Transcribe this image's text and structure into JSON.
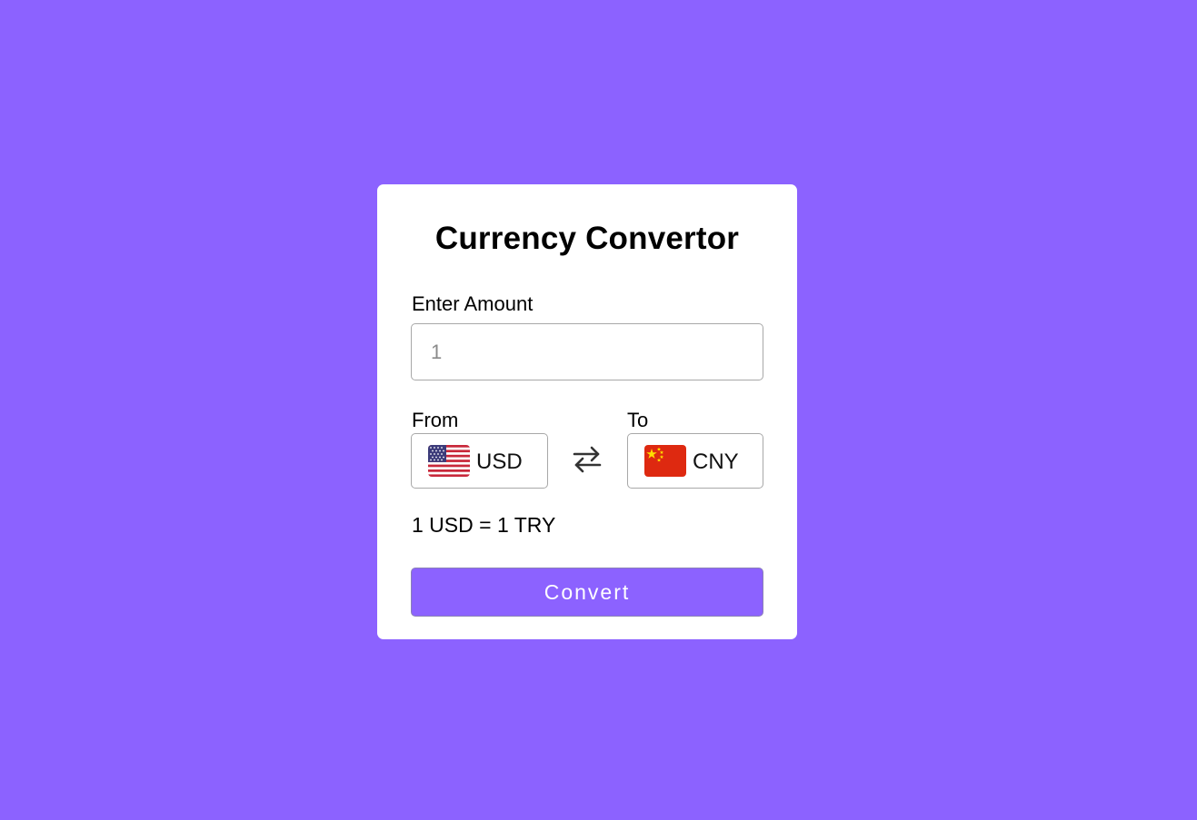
{
  "card": {
    "title": "Currency Convertor",
    "amount_label": "Enter Amount",
    "amount_placeholder": "1",
    "from_label": "From",
    "to_label": "To",
    "from_currency": {
      "code": "USD",
      "flag": "us-flag-icon"
    },
    "to_currency": {
      "code": "CNY",
      "flag": "cn-flag-icon"
    },
    "swap_icon": "swap-arrows-icon",
    "rate_text": "1 USD = 1 TRY",
    "convert_label": "Convert"
  },
  "colors": {
    "background": "#8c62ff",
    "button": "#8c62ff",
    "card": "#ffffff"
  }
}
